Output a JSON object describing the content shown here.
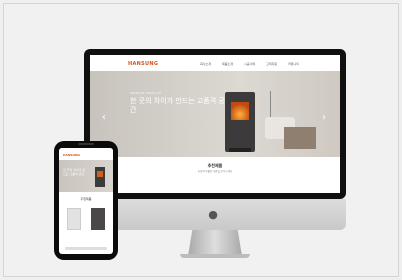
{
  "desktop": {
    "logo": "HANSUNG",
    "nav": [
      "회사소개",
      "제품소개",
      "시공사례",
      "고객지원",
      "커뮤니티"
    ],
    "hero_small": "PREMIUM FIREPLACE",
    "hero_title": "한 끗의 차이가 만드는 고품격 공간",
    "arrow_left": "‹",
    "arrow_right": "›",
    "section_title": "추천제품",
    "section_sub": "한성의 특별한 제품을 만나보세요"
  },
  "mobile": {
    "logo": "HANSUNG",
    "hero_title": "한 끗의 차이가 만드는 고품격 공간",
    "section_title": "추천제품"
  },
  "icons": {
    "apple": "apple-logo-icon"
  },
  "colors": {
    "brand": "#d0561b"
  }
}
